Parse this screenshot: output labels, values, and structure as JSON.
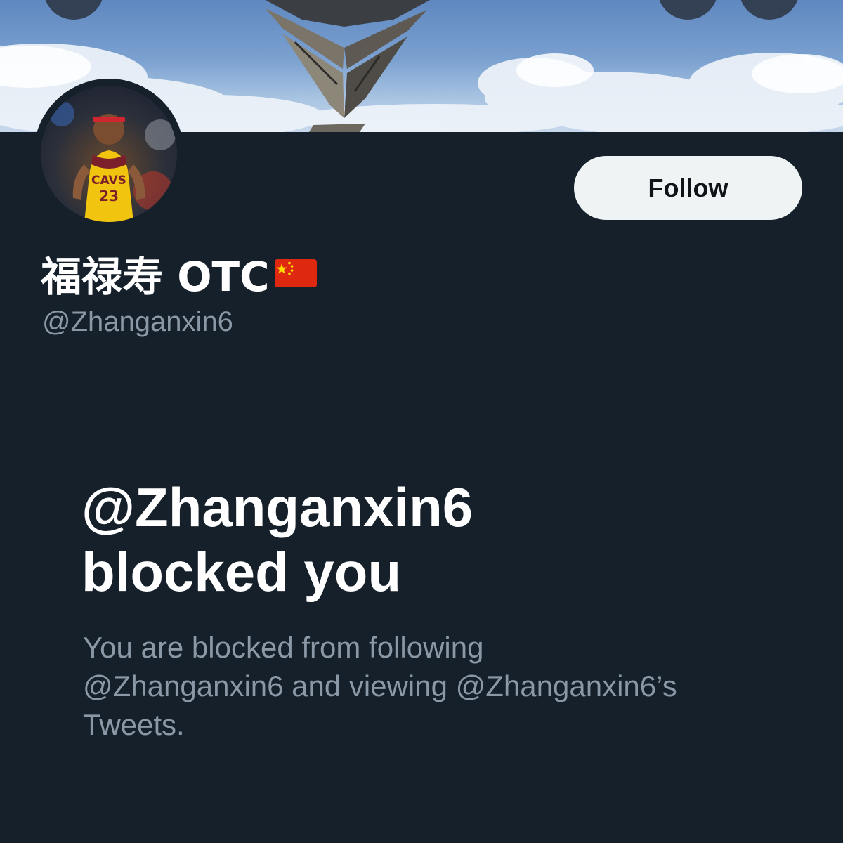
{
  "profile": {
    "display_name": "福禄寿 OTC",
    "flag": "🇨🇳",
    "handle": "@Zhanganxin6"
  },
  "actions": {
    "follow_label": "Follow"
  },
  "blocked": {
    "title_line1": "@Zhanganxin6",
    "title_line2": "blocked you",
    "desc_line1": "You are blocked from following",
    "desc_line2": "@Zhanganxin6 and viewing @Zhanganxin6’s",
    "desc_line3": "Tweets."
  },
  "icons": {
    "back": "back-icon",
    "search": "search-icon",
    "more": "more-icon"
  },
  "colors": {
    "background": "#15202b",
    "secondary_text": "#8b98a5",
    "follow_button_bg": "#eff3f4"
  }
}
